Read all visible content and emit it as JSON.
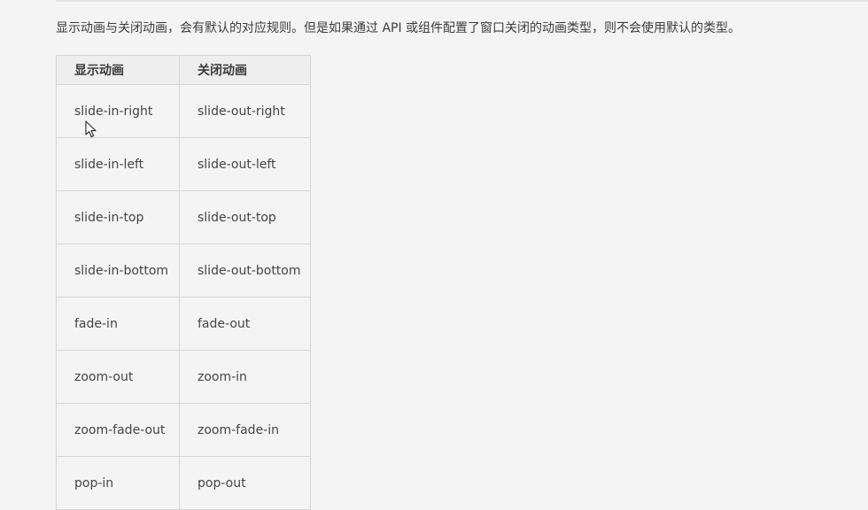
{
  "intro_text": "显示动画与关闭动画，会有默认的对应规则。但是如果通过 API 或组件配置了窗口关闭的动画类型，则不会使用默认的类型。",
  "table": {
    "headers": [
      "显示动画",
      "关闭动画"
    ],
    "rows": [
      [
        "slide-in-right",
        "slide-out-right"
      ],
      [
        "slide-in-left",
        "slide-out-left"
      ],
      [
        "slide-in-top",
        "slide-out-top"
      ],
      [
        "slide-in-bottom",
        "slide-out-bottom"
      ],
      [
        "fade-in",
        "fade-out"
      ],
      [
        "zoom-out",
        "zoom-in"
      ],
      [
        "zoom-fade-out",
        "zoom-fade-in"
      ],
      [
        "pop-in",
        "pop-out"
      ]
    ]
  },
  "cursor_icon": "arrow-cursor-icon"
}
